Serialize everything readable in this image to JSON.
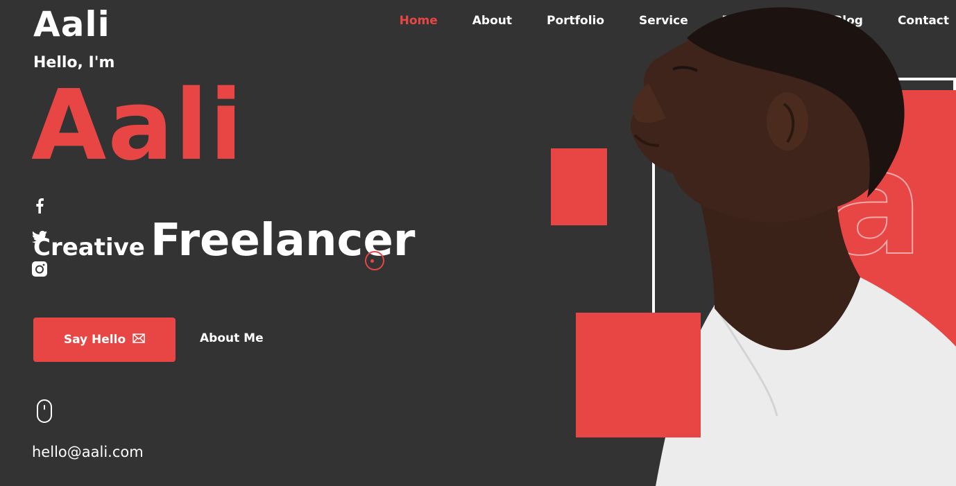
{
  "brand": "Aali",
  "nav": [
    "Home",
    "About",
    "Portfolio",
    "Service",
    "Testimonial",
    "Blog",
    "Contact"
  ],
  "hero": {
    "greeting": "Hello, I'm",
    "name": "Aali",
    "role_prefix": "Creative",
    "role": "Freelancer",
    "primary_button": "Say Hello",
    "secondary_button": "About Me",
    "email": "hello@aali.com",
    "big_letter": "a"
  },
  "social": [
    "facebook-icon",
    "twitter-icon",
    "instagram-icon"
  ],
  "colors": {
    "accent": "#e84545",
    "background": "#333333",
    "text": "#ffffff"
  }
}
